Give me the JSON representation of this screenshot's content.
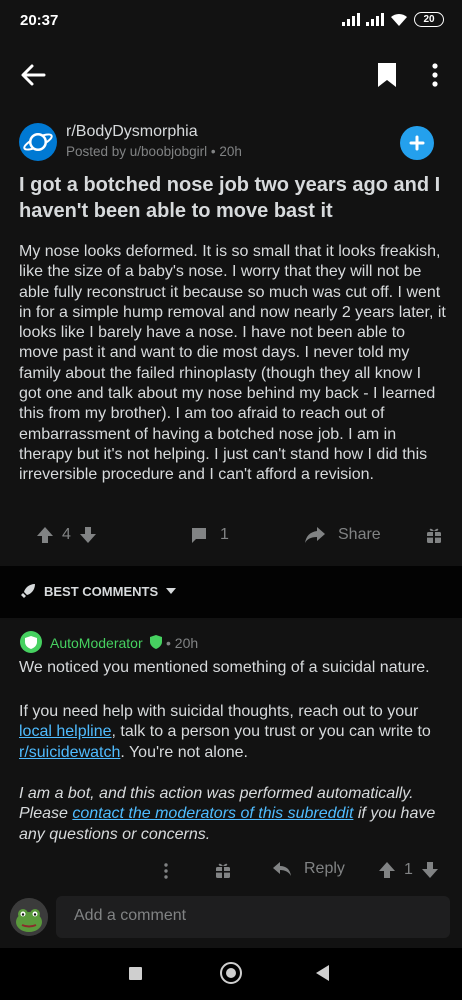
{
  "status_bar": {
    "time": "20:37",
    "battery": "20"
  },
  "post": {
    "subreddit": "r/BodyDysmorphia",
    "author": "Posted by u/boobjobgirl",
    "age": "20h",
    "title": "I got a botched nose job two years ago and I haven't been able to move bast it",
    "body": "My nose looks deformed. It is so small that it looks freakish, like the size of a baby's nose. I worry that they will not be able fully reconstruct it because so much was cut off. I went in for a simple hump removal and now nearly 2 years later, it looks like I barely have a nose. I have not been able to move past it and want to die most days. I never told my family about the failed rhinoplasty (though they all know I got one and talk about my nose behind my back - I learned this from my brother). I am too afraid to reach out of embarrassment of having a botched nose job. I am in therapy but it's not helping. I just can't stand how I did this irreversible procedure and I can't afford a revision.",
    "vote_count": "4",
    "comment_count": "1",
    "share_label": "Share"
  },
  "comments_header": {
    "label": "BEST COMMENTS"
  },
  "comment": {
    "author": "AutoModerator",
    "age": "20h",
    "p1": "We noticed you mentioned something of a suicidal nature.",
    "p2_before": "If you need help with suicidal thoughts, reach out to your ",
    "p2_link1": "local helpline",
    "p2_middle": ", talk to a person you trust or you can write to ",
    "p2_link2": "r/suicidewatch",
    "p2_after": ". You're not alone.",
    "p3_before": "I am a bot, and this action was performed automatically. Please ",
    "p3_link": "contact the moderators of this subreddit",
    "p3_after": " if you have any questions or concerns.",
    "reply_label": "Reply",
    "vote_count": "1"
  },
  "add_comment": {
    "placeholder": "Add a comment"
  },
  "colors": {
    "background": "#121212",
    "accent_blue": "#24a0ed",
    "mod_green": "#46d160",
    "link": "#4fbcff"
  }
}
